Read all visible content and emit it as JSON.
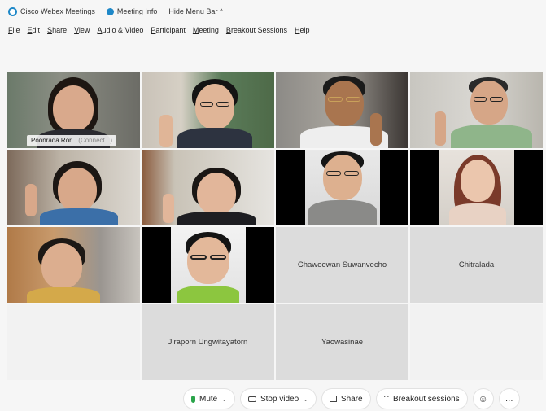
{
  "titlebar": {
    "app_name": "Cisco Webex Meetings",
    "meeting_info": "Meeting Info",
    "hide_menu": "Hide Menu Bar ^"
  },
  "menu": [
    "File",
    "Edit",
    "Share",
    "View",
    "Audio & Video",
    "Participant",
    "Meeting",
    "Breakout Sessions",
    "Help"
  ],
  "active_speaker": {
    "name": "Poonrada Ror...",
    "status": "(Connect...)"
  },
  "name_tiles": {
    "t1": "Chaweewan Suwanvecho",
    "t2": "Chitralada",
    "t3": "Jiraporn Ungwitayatorn",
    "t4": "Yaowasinae"
  },
  "controls": {
    "mute": "Mute",
    "stop_video": "Stop video",
    "share": "Share",
    "breakout": "Breakout sessions",
    "more": "…"
  },
  "colors": {
    "accent": "#2ab0e6",
    "mic_green": "#2aa44a"
  }
}
